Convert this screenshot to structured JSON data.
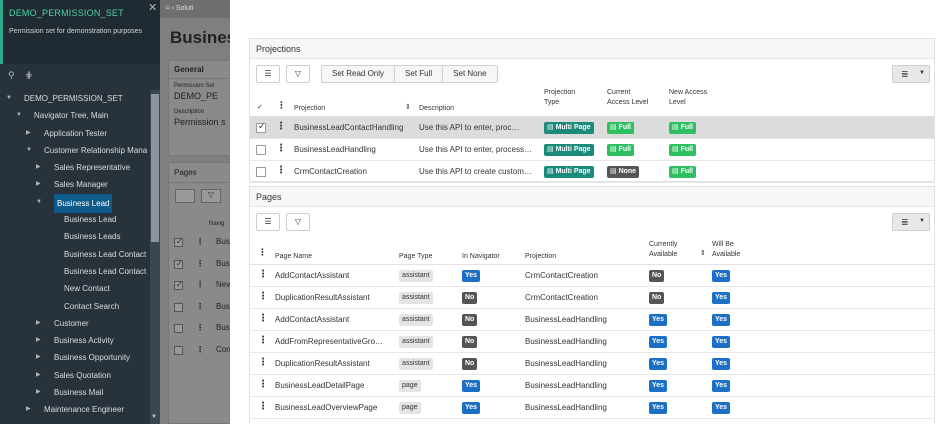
{
  "sidebar": {
    "title": "DEMO_PERMISSION_SET",
    "subtitle": "Permission set for demonstration purposes",
    "tree": [
      {
        "label": "DEMO_PERMISSION_SET",
        "indent": 0,
        "arrow": "▼"
      },
      {
        "label": "Navigator Tree, Main",
        "indent": 1,
        "arrow": "▼"
      },
      {
        "label": "Application Tester",
        "indent": 2,
        "arrow": "▶"
      },
      {
        "label": "Customer Relationship Mana",
        "indent": 2,
        "arrow": "▼"
      },
      {
        "label": "Sales Representative",
        "indent": 3,
        "arrow": "▶"
      },
      {
        "label": "Sales Manager",
        "indent": 3,
        "arrow": "▶"
      },
      {
        "label": "Business Lead",
        "indent": 3,
        "arrow": "▼",
        "selected": true
      },
      {
        "label": "Business Lead",
        "indent": 4,
        "arrow": ""
      },
      {
        "label": "Business Leads",
        "indent": 4,
        "arrow": ""
      },
      {
        "label": "Business Lead Contact",
        "indent": 4,
        "arrow": ""
      },
      {
        "label": "Business Lead Contact",
        "indent": 4,
        "arrow": ""
      },
      {
        "label": "New Contact",
        "indent": 4,
        "arrow": ""
      },
      {
        "label": "Contact Search",
        "indent": 4,
        "arrow": ""
      },
      {
        "label": "Customer",
        "indent": 3,
        "arrow": "▶"
      },
      {
        "label": "Business Activity",
        "indent": 3,
        "arrow": "▶"
      },
      {
        "label": "Business Opportunity",
        "indent": 3,
        "arrow": "▶"
      },
      {
        "label": "Sales Quotation",
        "indent": 3,
        "arrow": "▶"
      },
      {
        "label": "Business Mail",
        "indent": 3,
        "arrow": "▶"
      },
      {
        "label": "Maintenance Engineer",
        "indent": 2,
        "arrow": "▶"
      }
    ]
  },
  "mid": {
    "breadcrumb": "Soluti",
    "big_title": "Business",
    "general": "General",
    "perm_label": "Permission Set",
    "perm_value": "DEMO_PE",
    "desc_label": "Description",
    "desc_value": "Permission s",
    "pages": "Pages",
    "navig": "Navig",
    "rows": [
      "Bus",
      "Bus",
      "Nev",
      "Bus",
      "Bus",
      "Con"
    ]
  },
  "projections": {
    "title": "Projections",
    "actions": [
      "Set Read Only",
      "Set Full",
      "Set None"
    ],
    "headers": {
      "projection": "Projection",
      "description": "Description",
      "type": [
        "Projection",
        "Type"
      ],
      "current": [
        "Current",
        "Access Level"
      ],
      "new": [
        "New Access",
        "Level"
      ]
    },
    "rows": [
      {
        "name": "BusinessLeadContactHandling",
        "desc": "Use this API to enter, proc…",
        "type": "Multi Page",
        "current": "Full",
        "new": "Full",
        "checked": true
      },
      {
        "name": "BusinessLeadHandling",
        "desc": "Use this API to enter, process…",
        "type": "Multi Page",
        "current": "Full",
        "new": "Full",
        "checked": false
      },
      {
        "name": "CrmContactCreation",
        "desc": "Use this API to create custom…",
        "type": "Multi Page",
        "current": "None",
        "new": "Full",
        "checked": false
      }
    ]
  },
  "pages": {
    "title": "Pages",
    "headers": {
      "name": "Page Name",
      "type": "Page Type",
      "nav": "In Navigator",
      "proj": "Projection",
      "curr": [
        "Currently",
        "Available"
      ],
      "will": [
        "Will Be",
        "Available"
      ]
    },
    "rows": [
      {
        "name": "AddContactAssistant",
        "type": "assistant",
        "nav": "Yes",
        "proj": "CrmContactCreation",
        "curr": "No",
        "will": "Yes"
      },
      {
        "name": "DuplicationResultAssistant",
        "type": "assistant",
        "nav": "No",
        "proj": "CrmContactCreation",
        "curr": "No",
        "will": "Yes"
      },
      {
        "name": "AddContactAssistant",
        "type": "assistant",
        "nav": "No",
        "proj": "BusinessLeadHandling",
        "curr": "Yes",
        "will": "Yes"
      },
      {
        "name": "AddFromRepresentativeGro…",
        "type": "assistant",
        "nav": "No",
        "proj": "BusinessLeadHandling",
        "curr": "Yes",
        "will": "Yes"
      },
      {
        "name": "DuplicationResultAssistant",
        "type": "assistant",
        "nav": "No",
        "proj": "BusinessLeadHandling",
        "curr": "Yes",
        "will": "Yes"
      },
      {
        "name": "BusinessLeadDetailPage",
        "type": "page",
        "nav": "Yes",
        "proj": "BusinessLeadHandling",
        "curr": "Yes",
        "will": "Yes"
      },
      {
        "name": "BusinessLeadOverviewPage",
        "type": "page",
        "nav": "Yes",
        "proj": "BusinessLeadHandling",
        "curr": "Yes",
        "will": "Yes"
      }
    ]
  },
  "colors": {
    "accent": "#2ea88a",
    "teal": "#1a8a7a",
    "green": "#2fbf62",
    "blue": "#1b6fc4",
    "dark": "#555555"
  },
  "icons": {
    "close": "close-icon",
    "pin": "pin-icon",
    "tree": "tree-icon",
    "list": "list-icon",
    "filter": "filter-icon",
    "view": "table-view-icon"
  }
}
